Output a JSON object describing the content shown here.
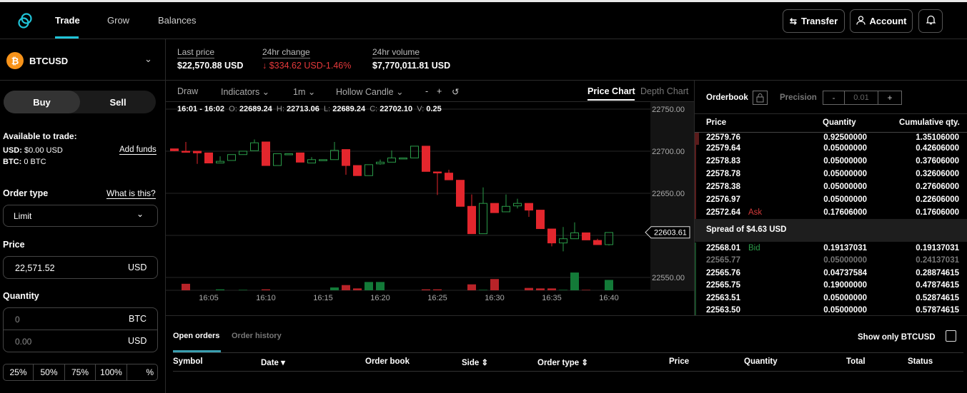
{
  "nav": {
    "tabs": [
      "Trade",
      "Grow",
      "Balances"
    ],
    "active": "Trade",
    "transfer": "Transfer",
    "account": "Account",
    "accent": "#20c4d8"
  },
  "market": {
    "symbol": "BTCUSD",
    "coin_glyph": "₿",
    "coin_color": "#f7931a"
  },
  "stats": {
    "last_price_label": "Last price",
    "last_price": "$22,570.88 USD",
    "change_label": "24hr change",
    "change": "↓ $334.62 USD-1.46%",
    "volume_label": "24hr volume",
    "volume": "$7,770,011.81 USD"
  },
  "order": {
    "buy": "Buy",
    "sell": "Sell",
    "available_label": "Available to trade:",
    "usd_label": "USD:",
    "usd_value": "$0.00 USD",
    "btc_label": "BTC:",
    "btc_value": "0 BTC",
    "add_funds": "Add funds",
    "order_type_label": "Order type",
    "what_is_this": "What is this?",
    "order_type": "Limit",
    "price_label": "Price",
    "price": "22,571.52",
    "price_unit": "USD",
    "quantity_label": "Quantity",
    "qty_btc_placeholder": "0",
    "qty_btc_unit": "BTC",
    "qty_usd_placeholder": "0.00",
    "qty_usd_unit": "USD",
    "percents": [
      "25%",
      "50%",
      "75%",
      "100%"
    ],
    "percent_custom": "%"
  },
  "toolbar": {
    "draw": "Draw",
    "indicators": "Indicators ⌄",
    "interval": "1m ⌄",
    "chart_type": "Hollow Candle ⌄",
    "zoom_out": "-",
    "zoom_in": "+",
    "reset": "↺",
    "price_chart": "Price Chart",
    "depth_chart": "Depth Chart"
  },
  "ohlc": {
    "range": "16:01 - 16:02",
    "o_label": "O:",
    "o": "22689.24",
    "h_label": "H:",
    "h": "22713.06",
    "l_label": "L:",
    "l": "22689.24",
    "c_label": "C:",
    "c": "22702.10",
    "v_label": "V:",
    "v": "0.25"
  },
  "chart_data": {
    "type": "candlestick",
    "style": "hollow",
    "ylim": [
      22545,
      22758
    ],
    "y_ticks": [
      "22750.00",
      "22700.00",
      "22650.00",
      "22600.00",
      "22550.00"
    ],
    "x_ticks": [
      "16:05",
      "16:10",
      "16:15",
      "16:20",
      "16:25",
      "16:30",
      "16:35",
      "16:40"
    ],
    "current_price": "22603.61",
    "up_color": "#2a9a48",
    "down_color": "#e3262d",
    "times": [
      "16:01",
      "16:02",
      "16:03",
      "16:04",
      "16:05",
      "16:06",
      "16:07",
      "16:08",
      "16:09",
      "16:10",
      "16:11",
      "16:12",
      "16:13",
      "16:14",
      "16:15",
      "16:16",
      "16:17",
      "16:18",
      "16:19",
      "16:20",
      "16:21",
      "16:22",
      "16:23",
      "16:24",
      "16:25",
      "16:26",
      "16:27",
      "16:28",
      "16:29",
      "16:30",
      "16:31",
      "16:32",
      "16:33",
      "16:34",
      "16:35",
      "16:36",
      "16:37",
      "16:38",
      "16:39",
      "16:40"
    ],
    "open": [
      22689.24,
      22702.8,
      22700,
      22700,
      22698,
      22686,
      22689,
      22696,
      22700.6,
      22711,
      22683,
      22697,
      22698,
      22686,
      22690,
      22690,
      22702,
      22683,
      22671,
      22685,
      22687,
      22692,
      22692,
      22706,
      22675.4,
      22674,
      22665.5,
      22634.5,
      22602,
      22638,
      22628,
      22635,
      22638,
      22630,
      22607.6,
      22591,
      22596,
      22603,
      22594,
      22589
    ],
    "high": [
      22713.06,
      22703,
      22711,
      22700,
      22698,
      22694,
      22696,
      22700,
      22714,
      22711,
      22697,
      22697,
      22698,
      22693,
      22690,
      22711,
      22702,
      22683,
      22684,
      22690,
      22701,
      22692,
      22706,
      22706,
      22675.4,
      22678,
      22665.5,
      22648.6,
      22657,
      22638,
      22648.6,
      22643.5,
      22638,
      22630,
      22607.6,
      22610,
      22615.5,
      22603,
      22596,
      22603.4
    ],
    "low": [
      22689.24,
      22700,
      22699,
      22685,
      22686,
      22685.6,
      22689,
      22696,
      22700.6,
      22683,
      22683,
      22697,
      22687,
      22686,
      22690,
      22690,
      22672,
      22671,
      22671,
      22684,
      22687,
      22692,
      22692,
      22676,
      22648,
      22666,
      22634.5,
      22602,
      22602,
      22627,
      22628,
      22632,
      22622,
      22608,
      22587,
      22581,
      22596,
      22594.6,
      22589,
      22588
    ],
    "close": [
      22702.1,
      22700.6,
      22699,
      22698,
      22686,
      22688,
      22696,
      22700,
      22710,
      22683,
      22697,
      22697,
      22687,
      22690,
      22690,
      22701,
      22683,
      22671,
      22684,
      22687,
      22692,
      22692,
      22706,
      22676,
      22674.3,
      22666,
      22634.5,
      22602,
      22638,
      22627,
      22634.5,
      22638,
      22630,
      22608,
      22591,
      22596,
      22603,
      22594.6,
      22589,
      22603.4
    ],
    "volume": [
      0.25,
      0,
      1.1,
      0,
      0,
      0.16,
      0,
      0.08,
      0,
      0.16,
      0,
      0,
      0,
      0,
      0,
      0.48,
      0.88,
      0.32,
      1.4,
      1.4,
      0,
      0,
      0,
      0.16,
      0.16,
      0,
      0,
      1.0,
      0.08,
      1.9,
      0,
      0,
      0.4,
      0.32,
      0.32,
      0.08,
      3.0,
      0.08,
      0,
      1.75
    ]
  },
  "orderbook": {
    "title": "Orderbook",
    "precision_label": "Precision",
    "precision_minus": "-",
    "precision_value": "0.01",
    "precision_plus": "+",
    "col_price": "Price",
    "col_qty": "Quantity",
    "col_cum": "Cumulative qty.",
    "asks": [
      {
        "price": "22579.76",
        "qty": "0.92500000",
        "cum": "1.35106000"
      },
      {
        "price": "22579.64",
        "qty": "0.05000000",
        "cum": "0.42606000"
      },
      {
        "price": "22578.83",
        "qty": "0.05000000",
        "cum": "0.37606000"
      },
      {
        "price": "22578.78",
        "qty": "0.05000000",
        "cum": "0.32606000"
      },
      {
        "price": "22578.38",
        "qty": "0.05000000",
        "cum": "0.27606000"
      },
      {
        "price": "22576.97",
        "qty": "0.05000000",
        "cum": "0.22606000"
      },
      {
        "price": "22572.64",
        "qty": "0.17606000",
        "cum": "0.17606000",
        "tag": "Ask"
      }
    ],
    "spread": "Spread of $4.63 USD",
    "bids": [
      {
        "price": "22568.01",
        "qty": "0.19137031",
        "cum": "0.19137031",
        "tag": "Bid"
      },
      {
        "price": "22565.77",
        "qty": "0.05000000",
        "cum": "0.24137031",
        "muted": true
      },
      {
        "price": "22565.76",
        "qty": "0.04737584",
        "cum": "0.28874615"
      },
      {
        "price": "22565.75",
        "qty": "0.19000000",
        "cum": "0.47874615"
      },
      {
        "price": "22563.51",
        "qty": "0.05000000",
        "cum": "0.52874615"
      },
      {
        "price": "22563.50",
        "qty": "0.05000000",
        "cum": "0.57874615"
      }
    ],
    "ask_color": "#d33a3a",
    "bid_color": "#2a9a48"
  },
  "orders": {
    "tabs": [
      "Open orders",
      "Order history"
    ],
    "show_only": "Show only BTCUSD",
    "columns": [
      "Symbol",
      "Date ▾",
      "Order book",
      "Side ⇕",
      "Order type ⇕",
      "Price",
      "Quantity",
      "Total",
      "Status"
    ]
  }
}
